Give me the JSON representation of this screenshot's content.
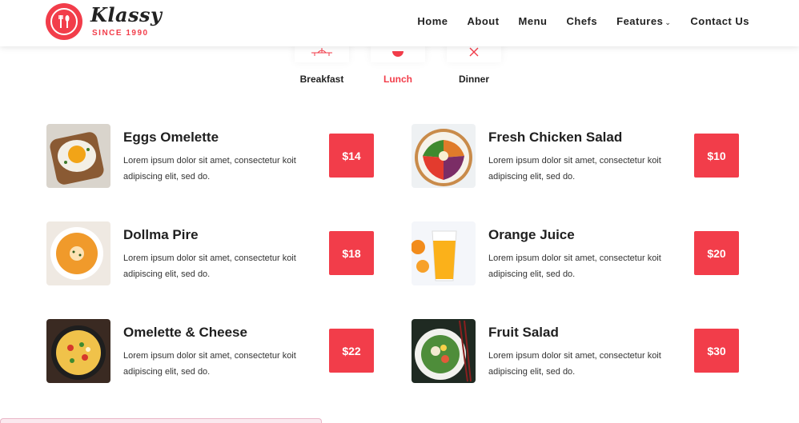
{
  "logo": {
    "title": "Klassy",
    "subtitle": "SINCE 1990"
  },
  "nav": {
    "items": [
      "Home",
      "About",
      "Menu",
      "Chefs",
      "Features",
      "Contact Us"
    ],
    "features_caret": "⌄"
  },
  "tabs": [
    {
      "label": "Breakfast",
      "active": false
    },
    {
      "label": "Lunch",
      "active": true
    },
    {
      "label": "Dinner",
      "active": false
    }
  ],
  "menu": [
    {
      "title": "Eggs Omelette",
      "desc": "Lorem ipsum dolor sit amet, consectetur koit adipiscing elit, sed do.",
      "price": "$14"
    },
    {
      "title": "Fresh Chicken Salad",
      "desc": "Lorem ipsum dolor sit amet, consectetur koit adipiscing elit, sed do.",
      "price": "$10"
    },
    {
      "title": "Dollma Pire",
      "desc": "Lorem ipsum dolor sit amet, consectetur koit adipiscing elit, sed do.",
      "price": "$18"
    },
    {
      "title": "Orange Juice",
      "desc": "Lorem ipsum dolor sit amet, consectetur koit adipiscing elit, sed do.",
      "price": "$20"
    },
    {
      "title": "Omelette & Cheese",
      "desc": "Lorem ipsum dolor sit amet, consectetur koit adipiscing elit, sed do.",
      "price": "$22"
    },
    {
      "title": "Fruit Salad",
      "desc": "Lorem ipsum dolor sit amet, consectetur koit adipiscing elit, sed do.",
      "price": "$30"
    }
  ],
  "colors": {
    "accent": "#f23d4a",
    "text": "#222222"
  }
}
